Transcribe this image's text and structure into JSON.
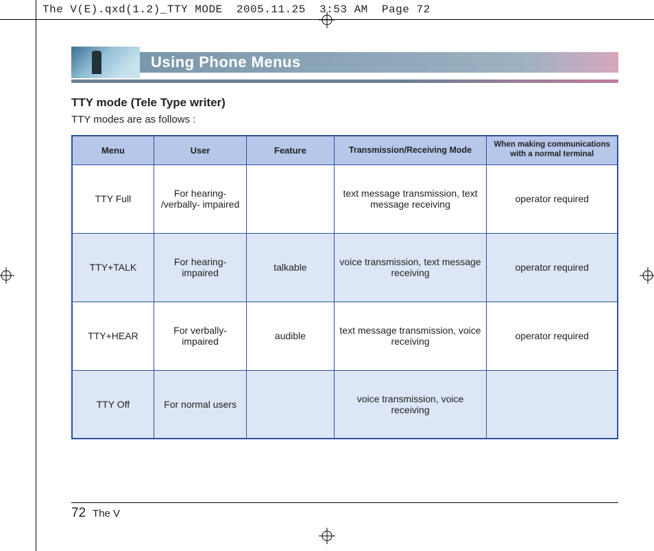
{
  "slug": "The V(E).qxd(1.2)_TTY MODE  2005.11.25  3:53 AM  Page 72",
  "banner": {
    "title": "Using Phone Menus"
  },
  "section": {
    "title": "TTY mode (Tele Type writer)",
    "sub": "TTY modes are as follows :"
  },
  "table": {
    "headers": {
      "menu": "Menu",
      "user": "User",
      "feature": "Feature",
      "mode": "Transmission/Receiving Mode",
      "normal": "When making communications with a normal terminal"
    },
    "rows": [
      {
        "menu": "TTY Full",
        "user": "For hearing- /verbally- impaired",
        "feature": "",
        "mode": "text message transmission, text message receiving",
        "normal": "operator required"
      },
      {
        "menu": "TTY+TALK",
        "user": "For hearing- impaired",
        "feature": "talkable",
        "mode": "voice transmission, text message receiving",
        "normal": "operator required"
      },
      {
        "menu": "TTY+HEAR",
        "user": "For verbally- impaired",
        "feature": "audible",
        "mode": "text message transmission, voice receiving",
        "normal": "operator required"
      },
      {
        "menu": "TTY Off",
        "user": "For normal users",
        "feature": "",
        "mode": "voice transmission, voice receiving",
        "normal": ""
      }
    ]
  },
  "footer": {
    "page_number": "72",
    "doc_name": "The V"
  }
}
